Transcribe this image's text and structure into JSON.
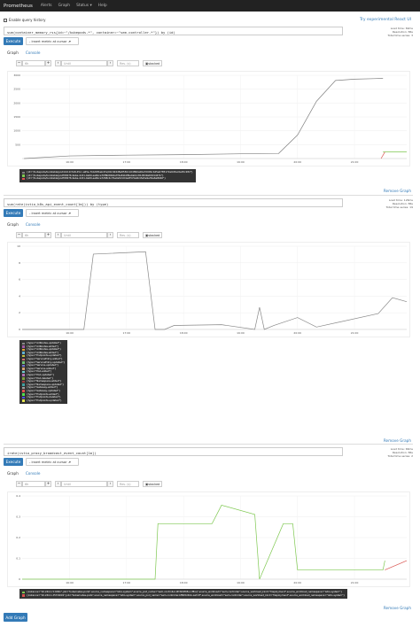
{
  "nav": {
    "brand": "Prometheus",
    "items": [
      "Alerts",
      "Graph",
      "Status ▾",
      "Help"
    ]
  },
  "top": {
    "query_history": "Enable query history",
    "try_ui": "Try experimental React UI"
  },
  "controls": {
    "execute": "Execute",
    "insert_metric": "- insert metric at cursor -",
    "tab_graph": "Graph",
    "tab_console": "Console",
    "range": "6h",
    "until": "Until",
    "res": "Res. (s)",
    "stacked": "stacked",
    "remove": "Remove Graph",
    "add_graph": "Add Graph"
  },
  "panels": [
    {
      "expr": "sum(container_memory_rss{id=~\"/kubepods.*\", container=~\"sem-controller.*\"}) by (id)",
      "stats": [
        "Load time: 69ms",
        "Resolution: 86s",
        "Total time series: 3"
      ],
      "y_ticks": [
        "3000",
        "2500",
        "2000",
        "1500",
        "1000",
        "500",
        ""
      ],
      "x_ticks": [
        "16:00",
        "17:00",
        "18:00",
        "19:00",
        "20:00",
        "21:00"
      ],
      "legend": [
        {
          "color": "#7f7f7f",
          "text": "{id=\"/kubepods/burstable/pod4cb11f-fe8-45cc-a65e-7bbd0fbeb47a/90c404d8e853b1104890a00e70009cb45e0785172e0d3ac0e45c28d\"}"
        },
        {
          "color": "#7ec850",
          "text": "{id=\"/kubepods/burstable/podf93676-9ebe-4c61-0e60-ea6bce70f8b80b6a7f4e81b0f9e0ab1c81d8d9a63d4d47b\"}"
        },
        {
          "color": "#d9534f",
          "text": "{id=\"/kubepods/burstable/podf93676-9ebe-4c61-0e60-ea6bce7268c4c7be9e52c04a4f3c5a0b43e5e9e39a6e8b60\"}"
        }
      ]
    },
    {
      "expr": "sum(rate(istio_k8s_api_event_count[1m])) by (type)",
      "stats": [
        "Load time: 126ms",
        "Resolution: 86s",
        "Total time series: 19"
      ],
      "y_ticks": [
        "10",
        "8",
        "6",
        "4",
        "2",
        "0"
      ],
      "x_ticks": [
        "16:00",
        "17:00",
        "18:00",
        "19:00",
        "20:00",
        "21:00"
      ],
      "legend": [
        {
          "color": "#888888",
          "text": "{type=\"AdRoutes-updated\"}"
        },
        {
          "color": "#a05aa0",
          "text": "{type=\"AdRoutes-added\"}"
        },
        {
          "color": "#e0a030",
          "text": "{type=\"AdRoutes-updated\"}"
        },
        {
          "color": "#60b0d0",
          "text": "{type=\"AdRoutes-added\"}"
        },
        {
          "color": "#c0c040",
          "text": "{type=\"Endpoints-updated\"}"
        },
        {
          "color": "#d07070",
          "text": "{type=\"ServiceEntry-added\"}"
        },
        {
          "color": "#70c070",
          "text": "{type=\"ServiceEntry-updated\"}"
        },
        {
          "color": "#7070d0",
          "text": "{type=\"Service-updated\"}"
        },
        {
          "color": "#d0a070",
          "text": "{type=\"Service-added\"}"
        },
        {
          "color": "#70d0d0",
          "text": "{type=\"Pod-added\"}"
        },
        {
          "color": "#b070b0",
          "text": "{type=\"Pod-updated\"}"
        },
        {
          "color": "#80a040",
          "text": "{type=\"Pod-deleted\"}"
        },
        {
          "color": "#a04040",
          "text": "{type=\"Namespace-added\"}"
        },
        {
          "color": "#40a0a0",
          "text": "{type=\"Namespace-updated\"}"
        },
        {
          "color": "#a0a0a0",
          "text": "{type=\"Gateway-added\"}"
        },
        {
          "color": "#e05050",
          "text": "{type=\"Gateway-updated\"}"
        },
        {
          "color": "#50e050",
          "text": "{type=\"Endpoints-added\"}"
        },
        {
          "color": "#5050e0",
          "text": "{type=\"Endpoints-deleted\"}"
        },
        {
          "color": "#e0e050",
          "text": "{type=\"Endpoints-updated\"}"
        }
      ]
    },
    {
      "expr": "irate(istio_proxy_broadcast_event_count[1m])",
      "stats": [
        "Load time: 66ms",
        "Resolution: 86s",
        "Total time series: 2"
      ],
      "y_ticks": [
        "0.4",
        "0.3",
        "0.2",
        "0.1",
        "0"
      ],
      "x_ticks": [
        "16:00",
        "17:00",
        "18:00",
        "19:00",
        "20:00",
        "21:00"
      ],
      "legend": [
        {
          "color": "#7ec850",
          "text": "{instance=\"10.244.1.5:9091\",job=\"kubernetes-pods\",source_namespace=\"istio-system\",source_pod_name=\"sem-controller-9fc8d4f98-nvf8xq\",source_workload=\"sem-controller\",source_workload_kind=\"Deployment\",source_workload_namespace=\"istio-system\"}"
        },
        {
          "color": "#d9534f",
          "text": "{instance=\"10.244.1.253:9091\",job=\"kubernetes-pods\",source_namespace=\"istio-system\",source_pod_name=\"sem-controller-bf8b5c6bb-xwh4f\",source_workload=\"sem-controller\",source_workload_kind=\"Deployment\",source_workload_namespace=\"istio-system\"}"
        }
      ]
    }
  ],
  "chart_data": [
    {
      "type": "line",
      "title": "",
      "ylim": [
        0,
        3200
      ],
      "xrange": [
        "15:10",
        "21:55"
      ],
      "series": [
        {
          "x": [
            "15:12",
            "16:00",
            "17:00",
            "18:00",
            "19:00",
            "19:40",
            "20:00",
            "20:20",
            "20:40",
            "21:00",
            "21:20",
            "21:30"
          ],
          "values": [
            0,
            100,
            130,
            150,
            180,
            190,
            900,
            2200,
            3000,
            3050,
            3070,
            3080
          ]
        },
        {
          "x": [
            "21:30",
            "21:55"
          ],
          "values": [
            250,
            260
          ]
        },
        {
          "x": [
            "21:28",
            "21:32"
          ],
          "values": [
            0,
            250
          ]
        }
      ]
    },
    {
      "type": "line",
      "title": "",
      "ylim": [
        0,
        10.5
      ],
      "xrange": [
        "15:10",
        "21:55"
      ],
      "series": [
        {
          "x": [
            "15:10",
            "16:15",
            "16:25",
            "17:20",
            "17:30",
            "17:40",
            "17:50",
            "18:40",
            "19:15",
            "19:20",
            "19:25",
            "19:35",
            "20:00",
            "20:20",
            "21:25",
            "21:40",
            "21:55"
          ],
          "values": [
            0,
            0,
            9.5,
            9.8,
            0,
            0,
            0.5,
            0.6,
            0,
            2.8,
            0,
            0.5,
            1.5,
            0.3,
            2.0,
            4.0,
            3.5
          ]
        }
      ]
    },
    {
      "type": "line",
      "title": "",
      "ylim": [
        0,
        0.45
      ],
      "xrange": [
        "15:10",
        "21:55"
      ],
      "series": [
        {
          "x": [
            "15:10",
            "17:30",
            "17:33",
            "18:30",
            "18:40",
            "19:15",
            "19:20",
            "19:45",
            "19:55",
            "20:00",
            "21:30",
            "21:32"
          ],
          "values": [
            0,
            0,
            0.3,
            0.3,
            0.4,
            0.35,
            0.0,
            0.3,
            0.3,
            0.05,
            0.05,
            0.1
          ]
        },
        {
          "x": [
            "21:32",
            "21:55"
          ],
          "values": [
            0.05,
            0.1
          ]
        }
      ]
    }
  ]
}
